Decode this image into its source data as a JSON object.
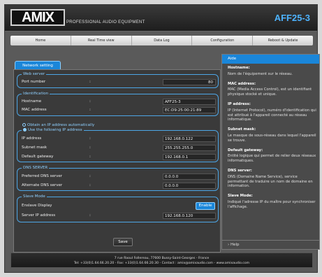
{
  "brand": {
    "logo": "AMIX",
    "tagline": "PROFESSIONAL AUDIO EQUIPMENT",
    "model": "AFF25-3"
  },
  "nav": [
    "Home",
    "Real Time view",
    "Data Log",
    "Configuration",
    "Reboot & Update"
  ],
  "tab": "Network setting",
  "web_server": {
    "title": "Web server",
    "port_label": "Port number",
    "port_value": "80"
  },
  "identification": {
    "title": "Identification",
    "hostname_label": "Hostname",
    "hostname_value": "AFF25-3",
    "mac_label": "MAC address",
    "mac_value": "EC:D9:25:00:21:89"
  },
  "ip": {
    "obtain_auto": "Obtain an IP address automatically",
    "use_following": "Use the following IP address",
    "address_label": "IP address",
    "address_value": "192.168.0.122",
    "subnet_label": "Subnet mask",
    "subnet_value": "255.255.255.0",
    "gateway_label": "Default gateway",
    "gateway_value": "192.168.0.1"
  },
  "dns": {
    "title": "DNS SERVER",
    "preferred_label": "Preferred DNS server",
    "preferred_value": "0.0.0.0",
    "alternate_label": "Alternate DNS server",
    "alternate_value": "0.0.0.0"
  },
  "slave": {
    "title": "Slave Mode",
    "enslave_label": "Enslave Display",
    "enable_button": "Enable",
    "server_ip_label": "Server IP address",
    "server_ip_value": "192.168.0.120"
  },
  "colon": ":",
  "save_button": "Save",
  "aide": {
    "title": "Aide",
    "items": [
      {
        "h": "Hostname:",
        "t": "Nom de l'équipement sur le réseau."
      },
      {
        "h": "MAC address:",
        "t": "MAC (Media Access Control), est un identifiant physique stocké et unique."
      },
      {
        "h": "IP address:",
        "t": "IP (Internet Protocol), numéro d'identification qui est attribué à l'appareil connecté au réseau informatique."
      },
      {
        "h": "Subnet mask:",
        "t": "Le masque de sous-réseau dans lequel l'appareil se trouve."
      },
      {
        "h": "Default gateway:",
        "t": "Entité logique qui permet de relier deux réseaux informatiques."
      },
      {
        "h": "DNS server:",
        "t": "DNS (Domaine Name Service), service permettant de traduire un nom de domaine en information."
      },
      {
        "h": "Slave Mode:",
        "t": "Indiqué l'adresse IP du maître pour synchroniser l'affichage."
      }
    ],
    "help": "› Help"
  },
  "footer": {
    "line1": "7 rue Raoul Follereau, 77600 Bussy-Saint-Georges - France",
    "line2": "Tel: +33(0)1.64.66.20.20 - Fax: +33(0)1.64.66.20.30 - Contact : amix@amixaudio.com - www.amixaudio.com"
  }
}
